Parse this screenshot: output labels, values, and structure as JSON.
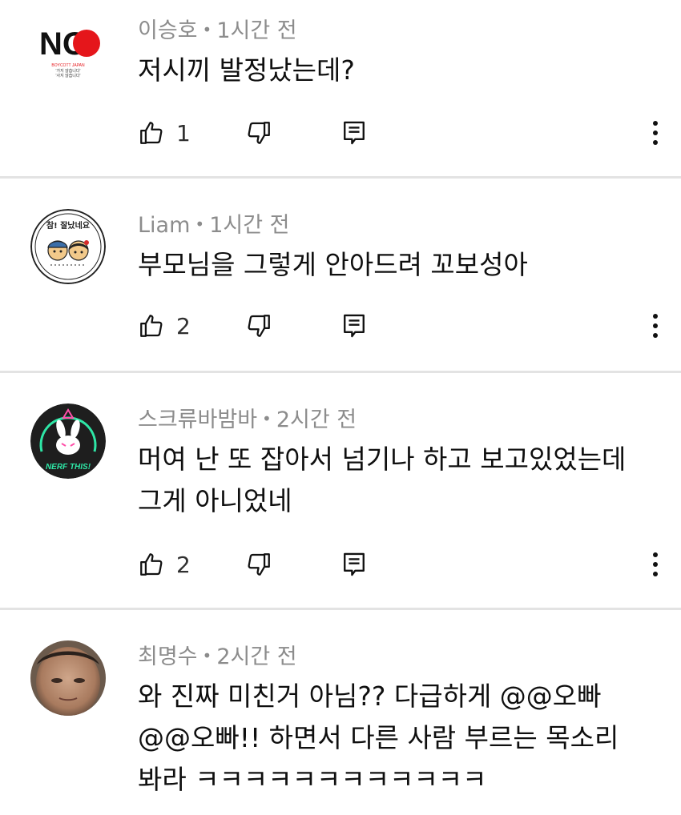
{
  "comments": [
    {
      "author": "이승호",
      "time": "1시간 전",
      "lines": [
        "저시끼 발정났는데?"
      ],
      "likes": "1",
      "avatar": {
        "letters": "NO",
        "small_lines": [
          "BOYCOTT JAPAN",
          "'가지 않습니다'",
          "'사지 않습니다'"
        ]
      }
    },
    {
      "author": "Liam",
      "time": "1시간 전",
      "lines": [
        "부모님을 그렇게 안아드려 꼬보성아"
      ],
      "likes": "2",
      "avatar": {
        "caption": "참! 잘났네요"
      }
    },
    {
      "author": "스크류바밤바",
      "time": "2시간 전",
      "lines": [
        "머여 난 또 잡아서 넘기나 하고 보고있었는데",
        "그게 아니었네"
      ],
      "likes": "2",
      "avatar": {
        "caption": "NERF THIS!"
      }
    },
    {
      "author": "최명수",
      "time": "2시간 전",
      "lines": [
        "와 진짜 미친거 아님??  다급하게 @@오빠",
        "@@오빠!! 하면서 다른 사람 부르는 목소리",
        "봐라 ㅋㅋㅋㅋㅋㅋㅋㅋㅋㅋㅋㅋ"
      ],
      "avatar": {}
    }
  ],
  "separator_dot": "•",
  "colors": {
    "meta_text": "#8c8c8c",
    "body_text": "#0f0f0f",
    "divider": "#e3e3e3",
    "no_red": "#e5161b"
  }
}
